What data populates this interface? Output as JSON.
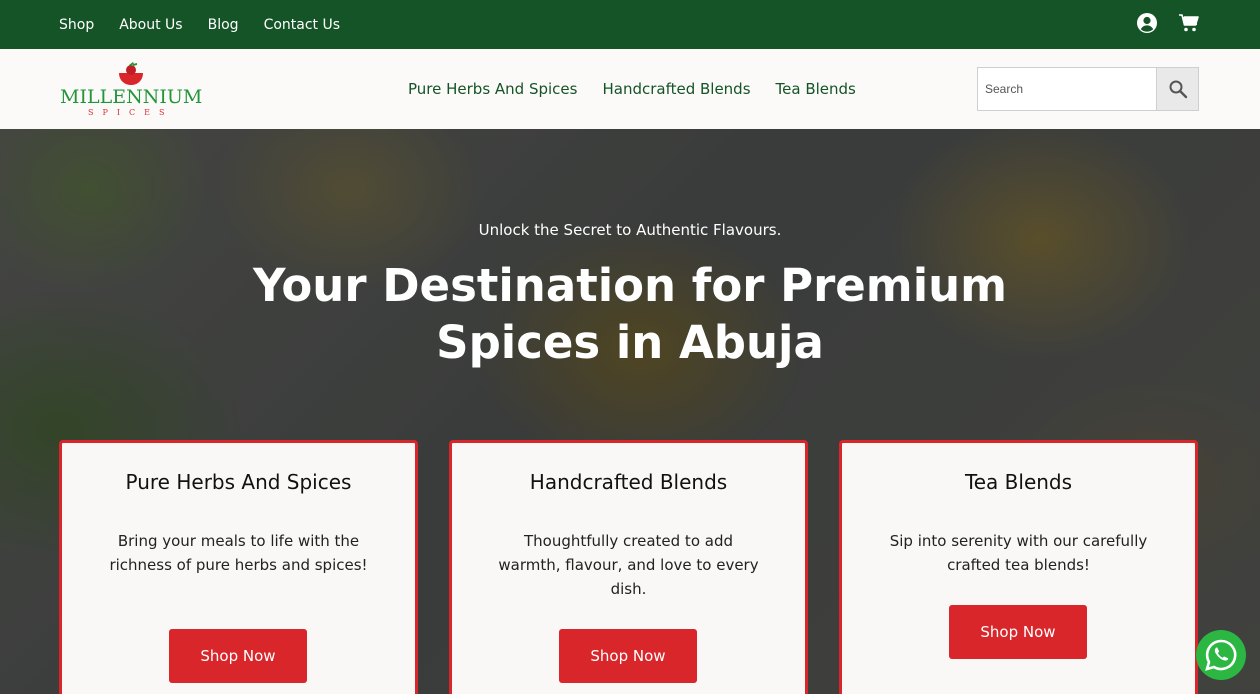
{
  "topbar": {
    "links": [
      "Shop",
      "About Us",
      "Blog",
      "Contact Us"
    ],
    "icons": [
      "account-icon",
      "cart-icon"
    ],
    "background": "#145427"
  },
  "header": {
    "logo": {
      "name": "MILLENNIUM",
      "sub": "SPICES"
    },
    "nav": [
      "Pure Herbs And Spices",
      "Handcrafted Blends",
      "Tea Blends"
    ],
    "search": {
      "placeholder": "Search",
      "icon": "search-icon"
    }
  },
  "hero": {
    "subtitle": "Unlock the Secret to Authentic Flavours.",
    "title": "Your Destination for Premium Spices in Abuja"
  },
  "cards": [
    {
      "title": "Pure Herbs And Spices",
      "text": "Bring your meals to life with the richness of pure herbs and spices!",
      "button": "Shop Now"
    },
    {
      "title": "Handcrafted Blends",
      "text": "Thoughtfully created to add warmth, flavour, and love to every dish.",
      "button": "Shop Now"
    },
    {
      "title": "Tea Blends",
      "text": "Sip into serenity with our carefully crafted tea blends!",
      "button": "Shop Now"
    }
  ],
  "colors": {
    "accent": "#d9262b",
    "brand_green": "#145427"
  },
  "floating": {
    "icon": "whatsapp-icon"
  }
}
